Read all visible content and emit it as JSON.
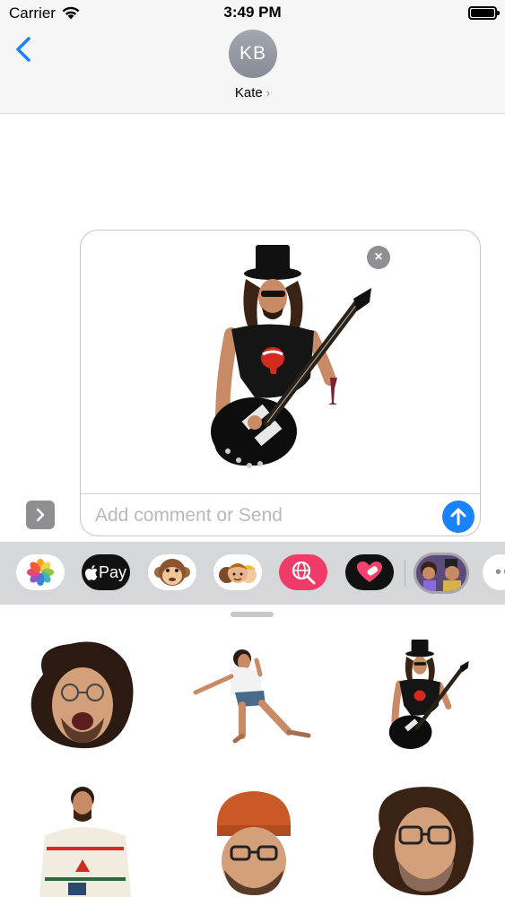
{
  "status_bar": {
    "carrier": "Carrier",
    "time": "3:49 PM"
  },
  "header": {
    "back_icon": "chevron-left-icon",
    "avatar_initials": "KB",
    "contact_name": "Kate",
    "contact_chevron": "›"
  },
  "compose": {
    "remove_icon": "×",
    "comment_placeholder": "Add comment or Send",
    "send_icon": "arrow-up-icon",
    "expand_icon": "chevron-right-icon"
  },
  "app_drawer": {
    "apps": [
      "Photos",
      "Apple Pay",
      "Animoji",
      "Memoji",
      "Images Search",
      "Digital Touch",
      "Stickers",
      "More"
    ],
    "applepay_label": "Pay",
    "more_label": "••"
  },
  "colors": {
    "accent_blue": "#1a82fb",
    "header_bg": "#f6f6f6",
    "drawer_bg": "#d6d7db",
    "search_app": "#f03a67"
  }
}
